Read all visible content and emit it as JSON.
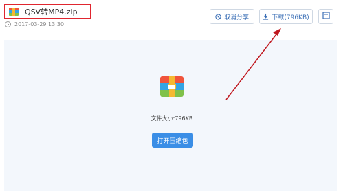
{
  "file": {
    "name": "QSV转MP4.zip",
    "date": "2017-03-29 13:30",
    "icon": "zip-archive-icon"
  },
  "toolbar": {
    "cancel_share_label": "取消分享",
    "cancel_share_icon": "no-share-icon",
    "download_label": "下载(796KB)",
    "download_icon": "download-icon",
    "more_icon": "save-icon"
  },
  "main": {
    "size_text": "文件大小:796KB",
    "open_label": "打开压缩包"
  },
  "colors": {
    "highlight_box": "#e0262f",
    "arrow": "#c0181f",
    "primary": "#3a8ee6",
    "content_bg": "#f3f7fc"
  }
}
